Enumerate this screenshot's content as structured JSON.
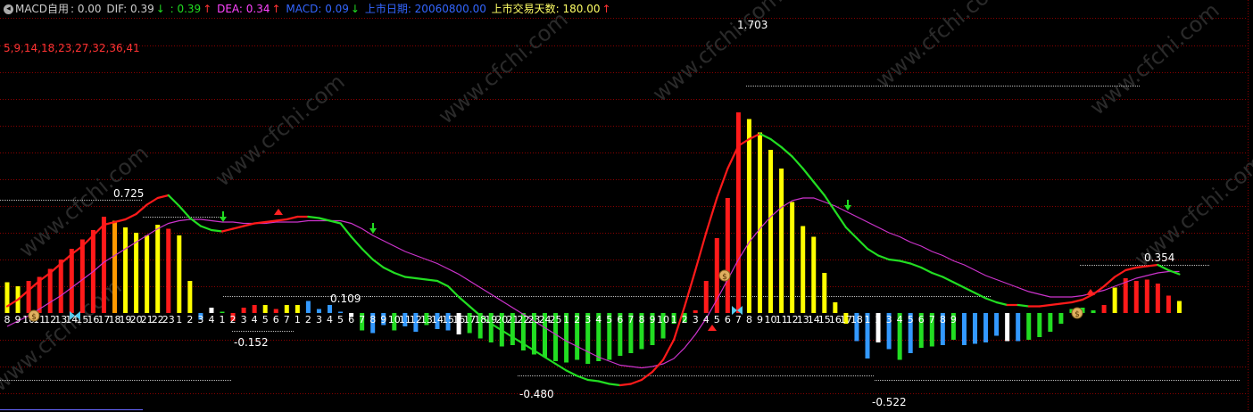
{
  "header": {
    "indicator_name": "MACD自用",
    "indicator_value": ": 0.00",
    "dif_label": "DIF: 0.39",
    "dif_value2": ": 0.39",
    "dea_label": "DEA: 0.34",
    "macd_label": "MACD: 0.09",
    "listing_date_label": "上市日期: 20060800.00",
    "trading_days_label": "上市交易天数: 180.00",
    "params": "5,9,14,18,23,27,32,36,41"
  },
  "annotations": {
    "peak_top": "1.703",
    "left_peak": "0.725",
    "small_peak": "0.109",
    "low1": "-0.152",
    "low2": "-0.480",
    "low3": "-0.522",
    "right_peak": "0.354"
  },
  "watermark": "www.cfchi.com",
  "colors": {
    "background": "#000000",
    "grid": "#8a0000",
    "red_bar": "#ff1a1a",
    "yellow_bar": "#ffff00",
    "orange_bar": "#ff9900",
    "blue_bar": "#3399ff",
    "green_bar": "#22dd22",
    "white_bar": "#ffffff",
    "dif_line": "#ff1a1a",
    "dif_line_down": "#22dd22",
    "dea_line": "#cc33cc",
    "header_default": "#cccccc",
    "header_green": "#22dd22",
    "header_magenta": "#ff44ff",
    "header_blue": "#3366ff",
    "header_yellow": "#ffff66",
    "params_red": "#ff3333",
    "count_label": "#ffffff"
  },
  "chart_data": {
    "type": "bar",
    "ylim": [
      -0.6,
      1.8
    ],
    "count_labels": [
      "8",
      "9",
      "10",
      "11",
      "12",
      "13",
      "14",
      "15",
      "16",
      "17",
      "18",
      "19",
      "20",
      "21",
      "22",
      "23",
      "1",
      "2",
      "3",
      "4",
      "1",
      "2",
      "3",
      "4",
      "5",
      "6",
      "7",
      "1",
      "2",
      "3",
      "4",
      "5",
      "6",
      "7",
      "8",
      "9",
      "10",
      "11",
      "12",
      "13",
      "14",
      "15",
      "16",
      "17",
      "18",
      "19",
      "20",
      "21",
      "22",
      "23",
      "24",
      "25",
      "1",
      "2",
      "3",
      "4",
      "5",
      "6",
      "7",
      "8",
      "9",
      "10",
      "1",
      "2",
      "3",
      "4",
      "5",
      "6",
      "7",
      "8",
      "9",
      "10",
      "11",
      "12",
      "13",
      "14",
      "15",
      "16",
      "17",
      "18",
      "1",
      "2",
      "3",
      "4",
      "5",
      "6",
      "7",
      "8",
      "9"
    ],
    "macd_values": [
      0.23,
      0.2,
      0.24,
      0.27,
      0.33,
      0.4,
      0.48,
      0.55,
      0.62,
      0.72,
      0.69,
      0.64,
      0.6,
      0.58,
      0.66,
      0.63,
      0.58,
      0.24,
      -0.05,
      0.04,
      0.01,
      -0.06,
      0.04,
      0.06,
      0.06,
      0.03,
      0.06,
      0.06,
      0.09,
      0.03,
      0.06,
      0.01,
      -0.03,
      -0.13,
      -0.15,
      -0.09,
      -0.13,
      -0.1,
      -0.14,
      -0.09,
      -0.12,
      -0.13,
      -0.16,
      -0.15,
      -0.19,
      -0.22,
      -0.25,
      -0.24,
      -0.28,
      -0.31,
      -0.33,
      -0.36,
      -0.37,
      -0.35,
      -0.38,
      -0.36,
      -0.35,
      -0.32,
      -0.3,
      -0.27,
      -0.24,
      -0.19,
      -0.08,
      -0.07,
      0.02,
      0.24,
      0.56,
      0.86,
      1.5,
      1.45,
      1.35,
      1.22,
      1.08,
      0.83,
      0.65,
      0.57,
      0.3,
      0.08,
      -0.08,
      -0.21,
      -0.34,
      -0.22,
      -0.27,
      -0.35,
      -0.3,
      -0.26,
      -0.25,
      -0.24,
      -0.2,
      -0.24,
      -0.23,
      -0.22,
      -0.17,
      -0.21,
      -0.21,
      -0.2,
      -0.18,
      -0.14,
      -0.08,
      0.03,
      0.04,
      0.02,
      0.06,
      0.19,
      0.26,
      0.24,
      0.25,
      0.22,
      0.13,
      0.09
    ],
    "bar_colors": [
      "yellow",
      "yellow",
      "red",
      "red",
      "red",
      "red",
      "red",
      "red",
      "red",
      "red",
      "orange",
      "yellow",
      "yellow",
      "yellow",
      "yellow",
      "red",
      "yellow",
      "yellow",
      "blue",
      "white",
      "green",
      "red",
      "red",
      "red",
      "yellow",
      "red",
      "yellow",
      "yellow",
      "blue",
      "blue",
      "blue",
      "blue",
      "white",
      "green",
      "blue",
      "blue",
      "green",
      "blue",
      "blue",
      "green",
      "blue",
      "blue",
      "white",
      "green",
      "green",
      "green",
      "green",
      "green",
      "green",
      "green",
      "green",
      "green",
      "green",
      "green",
      "green",
      "green",
      "green",
      "green",
      "green",
      "green",
      "green",
      "green",
      "green",
      "green",
      "red",
      "red",
      "red",
      "red",
      "red",
      "yellow",
      "yellow",
      "yellow",
      "yellow",
      "yellow",
      "yellow",
      "yellow",
      "yellow",
      "yellow",
      "yellow",
      "blue",
      "blue",
      "white",
      "blue",
      "green",
      "blue",
      "green",
      "green",
      "blue",
      "green",
      "blue",
      "blue",
      "blue",
      "blue",
      "white",
      "blue",
      "green",
      "green",
      "green",
      "green",
      "green",
      "green",
      "green",
      "red",
      "yellow",
      "red",
      "red",
      "red",
      "red",
      "red",
      "yellow",
      "red",
      "yellow",
      "yellow"
    ],
    "dif_line": [
      0.05,
      0.1,
      0.17,
      0.24,
      0.3,
      0.37,
      0.44,
      0.5,
      0.58,
      0.66,
      0.68,
      0.7,
      0.74,
      0.81,
      0.86,
      0.88,
      0.8,
      0.71,
      0.65,
      0.62,
      0.61,
      0.63,
      0.65,
      0.67,
      0.68,
      0.69,
      0.7,
      0.72,
      0.72,
      0.71,
      0.69,
      0.67,
      0.57,
      0.48,
      0.4,
      0.34,
      0.3,
      0.27,
      0.26,
      0.25,
      0.24,
      0.2,
      0.12,
      0.05,
      -0.02,
      -0.08,
      -0.13,
      -0.18,
      -0.23,
      -0.28,
      -0.33,
      -0.38,
      -0.43,
      -0.47,
      -0.5,
      -0.51,
      -0.53,
      -0.54,
      -0.53,
      -0.5,
      -0.44,
      -0.35,
      -0.2,
      0.05,
      0.32,
      0.6,
      0.86,
      1.08,
      1.25,
      1.3,
      1.34,
      1.3,
      1.24,
      1.17,
      1.08,
      0.98,
      0.88,
      0.76,
      0.64,
      0.56,
      0.48,
      0.43,
      0.4,
      0.39,
      0.37,
      0.34,
      0.3,
      0.27,
      0.23,
      0.19,
      0.15,
      0.11,
      0.08,
      0.06,
      0.06,
      0.05,
      0.05,
      0.06,
      0.07,
      0.08,
      0.1,
      0.14,
      0.2,
      0.27,
      0.32,
      0.34,
      0.35,
      0.36,
      0.32,
      0.29
    ],
    "dea_line": [
      -0.1,
      -0.06,
      -0.02,
      0.03,
      0.08,
      0.13,
      0.19,
      0.25,
      0.31,
      0.38,
      0.43,
      0.48,
      0.53,
      0.58,
      0.63,
      0.67,
      0.69,
      0.7,
      0.7,
      0.69,
      0.68,
      0.68,
      0.67,
      0.67,
      0.67,
      0.68,
      0.68,
      0.68,
      0.69,
      0.69,
      0.69,
      0.69,
      0.67,
      0.63,
      0.58,
      0.54,
      0.5,
      0.46,
      0.43,
      0.4,
      0.37,
      0.33,
      0.29,
      0.24,
      0.19,
      0.14,
      0.09,
      0.04,
      -0.01,
      -0.06,
      -0.11,
      -0.16,
      -0.21,
      -0.25,
      -0.29,
      -0.33,
      -0.36,
      -0.39,
      -0.4,
      -0.41,
      -0.4,
      -0.38,
      -0.34,
      -0.26,
      -0.16,
      -0.04,
      0.1,
      0.25,
      0.4,
      0.53,
      0.63,
      0.72,
      0.79,
      0.84,
      0.86,
      0.86,
      0.83,
      0.8,
      0.76,
      0.72,
      0.68,
      0.64,
      0.6,
      0.57,
      0.53,
      0.5,
      0.46,
      0.43,
      0.39,
      0.36,
      0.32,
      0.28,
      0.25,
      0.22,
      0.19,
      0.16,
      0.14,
      0.12,
      0.12,
      0.12,
      0.13,
      0.15,
      0.17,
      0.2,
      0.23,
      0.26,
      0.28,
      0.3,
      0.31,
      0.31
    ]
  }
}
